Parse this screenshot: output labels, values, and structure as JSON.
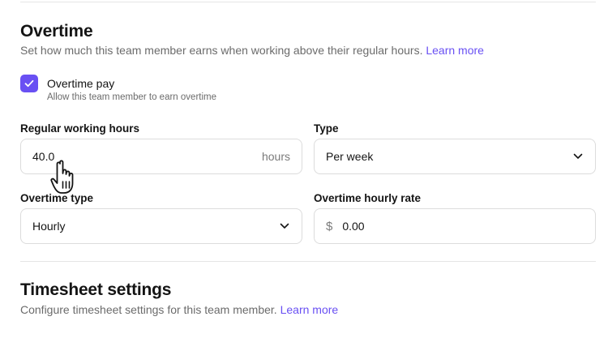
{
  "overtime": {
    "title": "Overtime",
    "description": "Set how much this team member earns when working above their regular hours.",
    "learn_more": "Learn more",
    "checkbox": {
      "checked": true,
      "label": "Overtime pay",
      "sublabel": "Allow this team member to earn overtime"
    },
    "regular_hours": {
      "label": "Regular working hours",
      "value": "40.0",
      "suffix": "hours"
    },
    "type": {
      "label": "Type",
      "value": "Per week"
    },
    "overtime_type": {
      "label": "Overtime type",
      "value": "Hourly"
    },
    "hourly_rate": {
      "label": "Overtime hourly rate",
      "prefix": "$",
      "value": "0.00"
    }
  },
  "timesheet": {
    "title": "Timesheet settings",
    "description": "Configure timesheet settings for this team member.",
    "learn_more": "Learn more"
  },
  "colors": {
    "accent": "#6950f3",
    "text": "#141414",
    "muted": "#6b6b6b",
    "border": "#dcdcdc"
  },
  "icons": [
    "check-icon",
    "chevron-down-icon",
    "hand-pointer-cursor-icon"
  ]
}
